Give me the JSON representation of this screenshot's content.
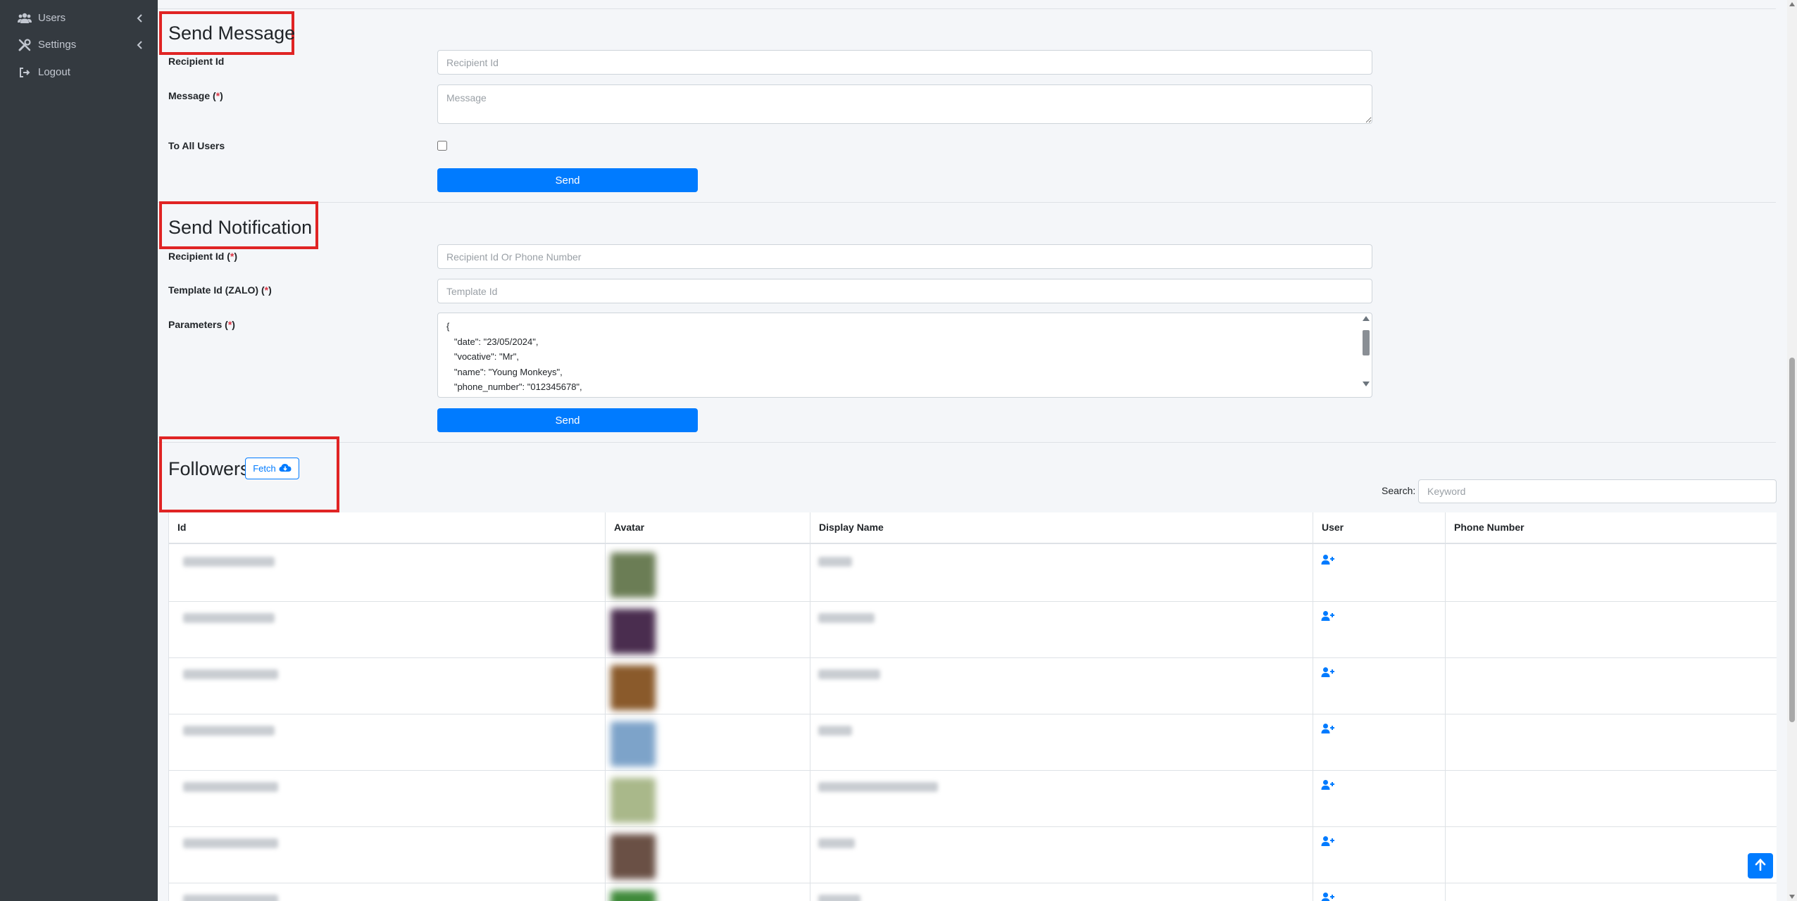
{
  "sidebar": {
    "items": [
      {
        "label": "Users",
        "icon": "users-icon",
        "chevron": "chevron-left-icon"
      },
      {
        "label": "Settings",
        "icon": "tools-icon",
        "chevron": "chevron-left-icon"
      },
      {
        "label": "Logout",
        "icon": "logout-icon"
      }
    ]
  },
  "send_message": {
    "title": "Send Message",
    "recipient_label": "Recipient Id",
    "recipient_placeholder": "Recipient Id",
    "message_label": "Message (",
    "message_req": "*",
    "message_label_end": ")",
    "message_placeholder": "Message",
    "to_all_label": "To All Users",
    "to_all_checked": false,
    "send_label": "Send"
  },
  "send_notification": {
    "title": "Send Notification",
    "recipient_label": "Recipient Id (",
    "recipient_placeholder": "Recipient Id Or Phone Number",
    "template_label": "Template Id (ZALO) (",
    "template_placeholder": "Template Id",
    "params_label": "Parameters (",
    "req": "*",
    "label_end": ")",
    "params_value": "{\n   \"date\": \"23/05/2024\",\n   \"vocative\": \"Mr\",\n   \"name\": \"Young Monkeys\",\n   \"phone_number\": \"012345678\",",
    "send_label": "Send"
  },
  "followers": {
    "title": "Followers",
    "fetch_label": "Fetch",
    "search_label": "Search:",
    "search_placeholder": "Keyword",
    "columns": [
      "Id",
      "Avatar",
      "Display Name",
      "User",
      "Phone Number"
    ],
    "avatar_colors": [
      "#6b7d55",
      "#4a2d4f",
      "#8a5a2b",
      "#7da3c9",
      "#a9b88a",
      "#6a5045",
      "#3f8a3a"
    ],
    "rows_count_visible": 7
  },
  "colors": {
    "accent": "#007bff",
    "sidebar": "#343a40",
    "highlight": "#e02424"
  }
}
